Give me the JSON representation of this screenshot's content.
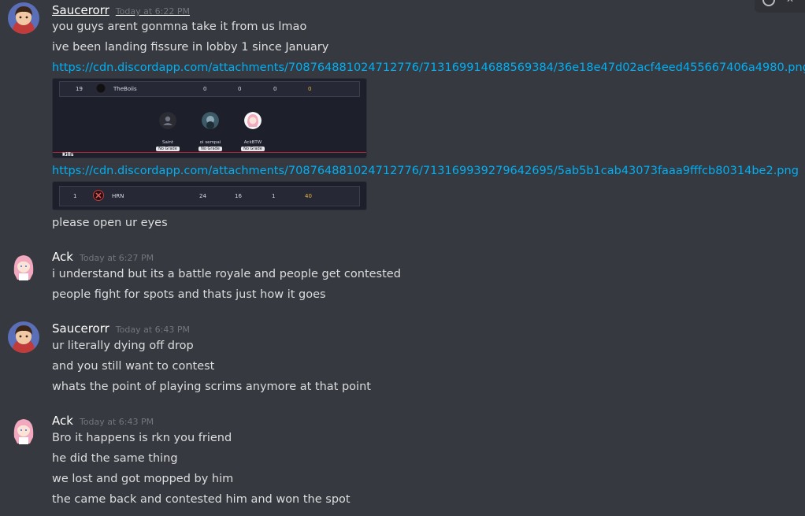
{
  "messages": [
    {
      "author": "Saucerorr",
      "timestamp": "Today at 6:22 PM",
      "lines": [
        "you guys arent gonmna take it from us lmao",
        "ive been landing fissure in lobby 1 since January"
      ],
      "link1": "https://cdn.discordapp.com/attachments/708764881024712776/713169914688569384/36e18e47d02acf4eed455667406a4980.png",
      "embed1": {
        "rank": "19",
        "team": "TheBoiis",
        "stats": [
          "0",
          "0",
          "0",
          "0"
        ],
        "players": [
          {
            "name": "Saint",
            "grade": "No Grade"
          },
          {
            "name": "oi sempai",
            "grade": "No Grade"
          },
          {
            "name": "AckBTW",
            "grade": "No Grade"
          }
        ],
        "kills_label": "Kills"
      },
      "link2": "https://cdn.discordapp.com/attachments/708764881024712776/713169939279642695/5ab5b1cab43073faaa9fffcb80314be2.png",
      "embed2": {
        "rank": "1",
        "team": "HRN",
        "stats": [
          "24",
          "16",
          "1",
          "40"
        ]
      },
      "after_line": "please open ur eyes"
    },
    {
      "author": "Ack",
      "timestamp": "Today at 6:27 PM",
      "lines": [
        "i understand but its a battle royale and people get contested",
        "people fight for spots and thats just how it goes"
      ]
    },
    {
      "author": "Saucerorr",
      "timestamp": "Today at 6:43 PM",
      "lines": [
        "ur literally dying off drop",
        "and you still want to contest",
        "whats the point of playing scrims anymore at that point"
      ]
    },
    {
      "author": "Ack",
      "timestamp": "Today at 6:43 PM",
      "lines": [
        "Bro it happens is rkn you friend",
        "he did the same thing",
        "we lost and got mopped by him",
        "the came back and contested him and won the spot"
      ]
    }
  ]
}
